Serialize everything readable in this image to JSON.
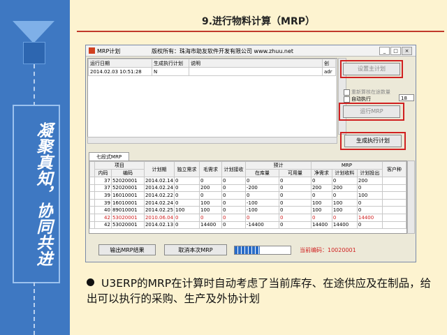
{
  "sidebar": {
    "vertical_text": "凝聚真知，协同共进"
  },
  "slide": {
    "title": "9.进行物料计算（MRP）"
  },
  "window": {
    "title": "MRP计划",
    "copyright": "版权所有：珠海市助友软件开发有限公司 www.zhuu.net",
    "controls": {
      "minimize": "_",
      "maximize": "□",
      "close": "×"
    },
    "top_grid": {
      "headers": [
        "运行日期",
        "生成执行计划",
        "说明",
        "创"
      ],
      "row": {
        "date": "2014.02.03 10:51:28",
        "generated": "N",
        "note": "",
        "creator": "adr"
      }
    },
    "buttons": {
      "set_master": "设置主计划",
      "run_mrp": "运行MRP",
      "generate_plan": "生成执行计划",
      "export_results": "输出MRP结果",
      "cancel_mrp": "取消本次MRP"
    },
    "options": {
      "recalc_in_transit": "重新算核在途数量",
      "auto_execute": "自动执行",
      "auto_value": "18"
    },
    "tab_label": "七段式MRP",
    "lower_grid": {
      "group_headers": {
        "item": "项目",
        "stock": "预计",
        "mrp": "MRP"
      },
      "headers": [
        "内码",
        "编码",
        "计划期",
        "独立需求",
        "毛需求",
        "计划接收",
        "在库量",
        "可用量",
        "净需求",
        "计划收料",
        "计划投出",
        "客户种"
      ],
      "rows": [
        {
          "id": "37",
          "code": "52020001",
          "date": "2014.02.14",
          "ind": "0",
          "gross": "0",
          "recv": "0",
          "stock": "0",
          "avail": "0",
          "net": "0",
          "plan_in": "0",
          "plan_out": "200",
          "cust": "",
          "red": false
        },
        {
          "id": "37",
          "code": "52020001",
          "date": "2014.02.24",
          "ind": "0",
          "gross": "200",
          "recv": "0",
          "stock": "-200",
          "avail": "0",
          "net": "200",
          "plan_in": "200",
          "plan_out": "0",
          "cust": "",
          "red": false
        },
        {
          "id": "39",
          "code": "16010001",
          "date": "2014.02.22",
          "ind": "0",
          "gross": "0",
          "recv": "0",
          "stock": "0",
          "avail": "0",
          "net": "0",
          "plan_in": "0",
          "plan_out": "100",
          "cust": "",
          "red": false
        },
        {
          "id": "39",
          "code": "16010001",
          "date": "2014.02.24",
          "ind": "0",
          "gross": "100",
          "recv": "0",
          "stock": "-100",
          "avail": "0",
          "net": "100",
          "plan_in": "100",
          "plan_out": "0",
          "cust": "",
          "red": false
        },
        {
          "id": "40",
          "code": "89010001",
          "date": "2014.02.25",
          "ind": "100",
          "gross": "100",
          "recv": "0",
          "stock": "-100",
          "avail": "0",
          "net": "100",
          "plan_in": "100",
          "plan_out": "0",
          "cust": "",
          "red": false
        },
        {
          "id": "42",
          "code": "53020001",
          "date": "2010.06.04",
          "ind": "0",
          "gross": "0",
          "recv": "0",
          "stock": "0",
          "avail": "0",
          "net": "0",
          "plan_in": "0",
          "plan_out": "14400",
          "cust": "",
          "red": true
        },
        {
          "id": "42",
          "code": "53020001",
          "date": "2014.02.13",
          "ind": "0",
          "gross": "14400",
          "recv": "0",
          "stock": "-14400",
          "avail": "0",
          "net": "14400",
          "plan_in": "14400",
          "plan_out": "0",
          "cust": "",
          "red": false
        }
      ]
    },
    "progress": {
      "fraction": 0.45
    },
    "current_code": "当前编码：10020001"
  },
  "bullet_text": "U3ERP的MRP在计算时自动考虑了当前库存、在途供应及在制品，给出可以执行的采购、生产及外协计划"
}
